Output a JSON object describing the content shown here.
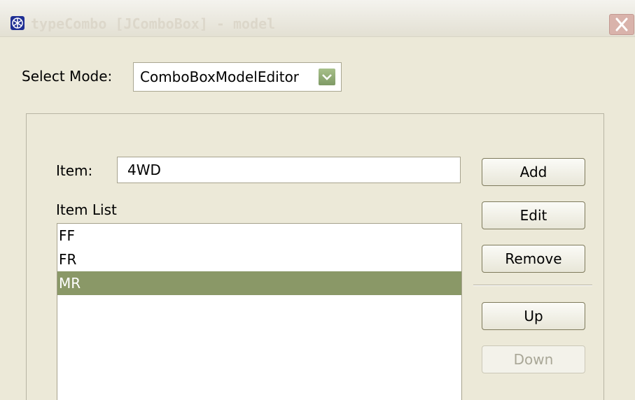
{
  "window": {
    "title": "typeCombo [JComboBox] - model",
    "app_icon": "snowflake-icon",
    "close_icon": "close-icon"
  },
  "mode": {
    "label": "Select Mode:",
    "selected": "ComboBoxModelEditor",
    "dropdown_icon": "chevron-down-icon"
  },
  "editor": {
    "item_label": "Item:",
    "item_value": "4WD",
    "list_label": "Item List",
    "items": [
      "FF",
      "FR",
      "MR"
    ],
    "selected_item": "MR"
  },
  "buttons": {
    "add": "Add",
    "edit": "Edit",
    "remove": "Remove",
    "up": "Up",
    "down": "Down"
  },
  "colors": {
    "selection": "#8a9867",
    "close_button": "#d9b3ab",
    "dropdown_button": "#8faa74"
  }
}
